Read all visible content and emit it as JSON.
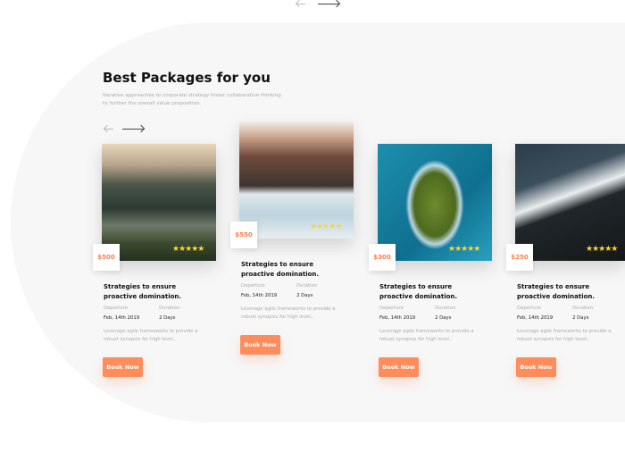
{
  "section": {
    "title": "Best Packages for you",
    "subtitle": "Iterative approaches to corporate strategy foster collaborative thinking to further the overall value proposition."
  },
  "packages": [
    {
      "price": "$500",
      "rating": 5,
      "title": "Strategies to ensure proactive domination.",
      "departure_label": "Deperture",
      "departure": "Feb, 14th 2019",
      "duration_label": "Duration",
      "duration": "2 Days",
      "description": "Leverage agile frameworks to provide a robust synopsis for high level..",
      "button": "Book Now"
    },
    {
      "price": "$550",
      "rating": 5,
      "title": "Strategies to ensure proactive domination.",
      "departure_label": "Deperture",
      "departure": "Feb, 14th 2019",
      "duration_label": "Duration",
      "duration": "2 Days",
      "description": "Leverage agile frameworks to provide a robust synopsis for high level..",
      "button": "Book Now"
    },
    {
      "price": "$300",
      "rating": 5,
      "title": "Strategies to ensure proactive domination.",
      "departure_label": "Deperture",
      "departure": "Feb, 14th 2019",
      "duration_label": "Duration",
      "duration": "2 Days",
      "description": "Leverage agile frameworks to provide a robust synopsis for high level..",
      "button": "Book Now"
    },
    {
      "price": "$250",
      "rating": 5,
      "title": "Strategies to ensure proactive domination.",
      "departure_label": "Deperture",
      "departure": "Feb, 14th 2019",
      "duration_label": "Duration",
      "duration": "2 Days",
      "description": "Leverage agile frameworks to provide a robust synopsis for high level..",
      "button": "Book Now"
    }
  ],
  "stars": "★★★★★",
  "colors": {
    "accent": "#ff8d5c",
    "star": "#ffd630"
  }
}
